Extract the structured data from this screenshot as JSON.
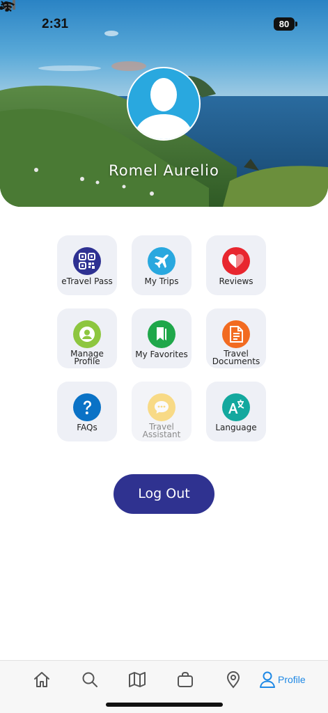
{
  "status_bar": {
    "time": "2:31",
    "battery": "80"
  },
  "profile": {
    "name": "Romel Aurelio"
  },
  "menu": [
    {
      "label": "eTravel Pass",
      "icon": "qr-code-icon",
      "color": "#2e3192"
    },
    {
      "label": "My Trips",
      "icon": "airplane-icon",
      "color": "#29a8df"
    },
    {
      "label": "Reviews",
      "icon": "heart-icon",
      "color": "#e8262f"
    },
    {
      "label": "Manage\nProfile",
      "line1": "Manage",
      "line2": "Profile",
      "icon": "user-icon",
      "color": "#8dc63f"
    },
    {
      "label": "My Favorites",
      "icon": "bookmark-icon",
      "color": "#1fa74a"
    },
    {
      "label": "Travel\nDocuments",
      "line1": "Travel",
      "line2": "Documents",
      "icon": "document-icon",
      "color": "#f26b21"
    },
    {
      "label": "FAQs",
      "icon": "question-icon",
      "color": "#0a72c6"
    },
    {
      "label": "Travel\nAssistant",
      "line1": "Travel",
      "line2": "Assistant",
      "icon": "chat-icon",
      "color": "#fcc93b"
    },
    {
      "label": "Language",
      "icon": "translate-icon",
      "color": "#13a89e"
    }
  ],
  "logout_label": "Log Out",
  "bottom_nav": {
    "items": [
      "home-icon",
      "search-icon",
      "map-icon",
      "bag-icon",
      "location-pin-icon",
      "profile-icon"
    ],
    "active_label": "Profile",
    "active_color": "#1e88e5"
  }
}
